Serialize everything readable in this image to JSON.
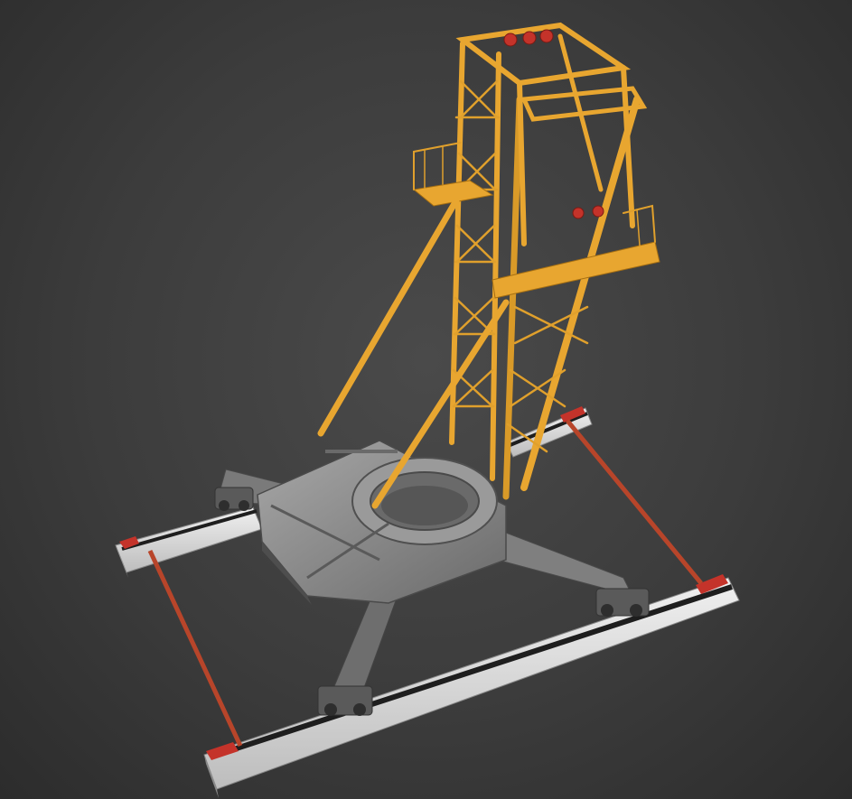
{
  "viewport": {
    "background": "#3a3a3a"
  },
  "scene": {
    "subject": "crane-on-rails-3d-model",
    "colors": {
      "mast": "#e8a630",
      "mast_shadow": "#b87a18",
      "base": "#8a8a8a",
      "base_dark": "#5e5e5e",
      "rail": "#d8d8d8",
      "rail_dark": "#1e1e1e",
      "tie_bar": "#b8452a",
      "bumper": "#c4332a"
    }
  }
}
